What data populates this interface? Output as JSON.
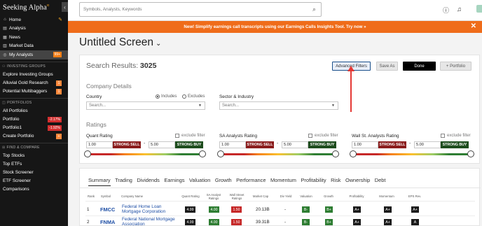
{
  "logo": {
    "text": "Seeking Alpha",
    "mark": "α"
  },
  "sidebar": {
    "collapse_glyph": "‹",
    "main": [
      {
        "icon": "home-icon",
        "glyph": "⌂",
        "label": "Home"
      },
      {
        "icon": "analysis-icon",
        "glyph": "▤",
        "label": "Analysis"
      },
      {
        "icon": "news-icon",
        "glyph": "▦",
        "label": "News"
      },
      {
        "icon": "market-data-icon",
        "glyph": "▥",
        "label": "Market Data"
      },
      {
        "icon": "my-analysts-icon",
        "glyph": "◎",
        "label": "My Analysts",
        "badge": "99+"
      }
    ],
    "investing_groups": {
      "heading": "INVESTING GROUPS",
      "items": [
        {
          "label": "Explore Investing Groups"
        },
        {
          "label": "Alluvial Gold Research",
          "badge": "1"
        },
        {
          "label": "Potential Multibaggers",
          "badge": "1"
        }
      ]
    },
    "portfolios": {
      "heading": "PORTFOLIOS",
      "items": [
        {
          "label": "All Portfolios"
        },
        {
          "label": "Portfolio",
          "badge": "-2.17%"
        },
        {
          "label": "Portfolio1",
          "badge": "-1.92%"
        },
        {
          "label": "Create Portfolio",
          "badge": "+"
        }
      ]
    },
    "find": {
      "heading": "FIND & COMPARE",
      "items": [
        {
          "label": "Top Stocks"
        },
        {
          "label": "Top ETFs"
        },
        {
          "label": "Stock Screener"
        },
        {
          "label": "ETF Screener"
        },
        {
          "label": "Comparisons"
        }
      ]
    }
  },
  "topbar": {
    "search_placeholder": "Symbols, Analysts, Keywords",
    "help_glyph": "?",
    "bell_glyph": "🔔"
  },
  "promo": {
    "text": "New! Simplify earnings call transcripts using our Earnings Calls Insights Tool. Try now »",
    "close": "✕"
  },
  "page": {
    "title": "Untitled Screen",
    "chevron": "⌄"
  },
  "results": {
    "label": "Search Results:",
    "count": "3025"
  },
  "buttons": {
    "advanced": "Advanced Filters",
    "save_as": "Save As",
    "done": "Done",
    "portfolio": "+ Portfolio"
  },
  "company_details": {
    "heading": "Company Details",
    "country_label": "Country",
    "includes": "Includes",
    "excludes": "Excludes",
    "country_placeholder": "Search...",
    "sector_label": "Sector & Industry",
    "sector_placeholder": "Search..."
  },
  "ratings": {
    "heading": "Ratings",
    "exclude_filter": "exclude filter",
    "groups": [
      {
        "label": "Quant Rating",
        "min": "1.00",
        "min_label": "STRONG SELL",
        "max": "5.00",
        "max_label": "STRONG BUY"
      },
      {
        "label": "SA Analysts Rating",
        "min": "1.00",
        "min_label": "STRONG SELL",
        "max": "5.00",
        "max_label": "STRONG BUY"
      },
      {
        "label": "Wall St. Analysts Rating",
        "min": "1.00",
        "min_label": "STRONG SELL",
        "max": "5.00",
        "max_label": "STRONG BUY"
      }
    ]
  },
  "tabs": [
    "Summary",
    "Trading",
    "Dividends",
    "Earnings",
    "Valuation",
    "Growth",
    "Performance",
    "Momentum",
    "Profitability",
    "Risk",
    "Ownership",
    "Debt"
  ],
  "table": {
    "headers": [
      "Rank",
      "Symbol",
      "Company Name",
      "Quant Rating",
      "SA Analyst Ratings",
      "Wall Street Ratings",
      "Market Cap",
      "Div Yield",
      "Valuation",
      "Growth",
      "Profitability",
      "Momentum",
      "EPS Rev."
    ],
    "rows": [
      {
        "rank": "1",
        "symbol": "FMCC",
        "company": "Federal Home Loan Mortgage Corporation",
        "quant": "4.99",
        "sa": "4.00",
        "ws": "1.50",
        "cap": "20.13B",
        "div": "-",
        "valuation": "B-",
        "growth": "B+",
        "profitability": "A+",
        "momentum": "A+",
        "eps": "A+"
      },
      {
        "rank": "2",
        "symbol": "FNMA",
        "company": "Federal National Mortgage Association",
        "quant": "4.99",
        "sa": "4.00",
        "ws": "1.50",
        "cap": "39.31B",
        "div": "-",
        "valuation": "B-",
        "growth": "B+",
        "profitability": "A+",
        "momentum": "A+",
        "eps": "A"
      }
    ]
  }
}
